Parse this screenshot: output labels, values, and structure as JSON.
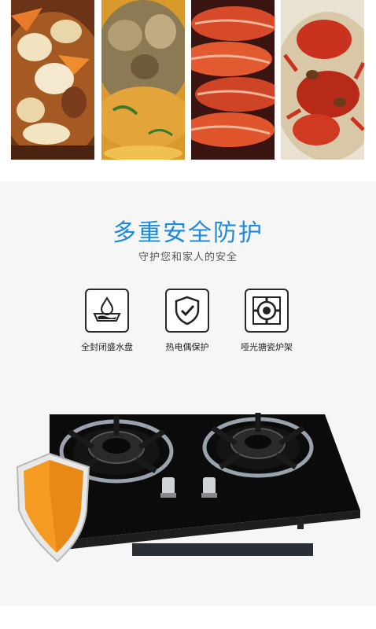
{
  "food_gallery": {
    "photos": [
      {
        "name": "stew-dish-photo"
      },
      {
        "name": "soup-pot-photo"
      },
      {
        "name": "prawns-photo"
      },
      {
        "name": "crabs-photo"
      }
    ]
  },
  "safety": {
    "title": "多重安全防护",
    "subtitle": "守护您和家人的安全",
    "features": [
      {
        "icon": "water-drop-pan-icon",
        "label": "全封闭盛水盘"
      },
      {
        "icon": "shield-check-icon",
        "label": "热电偶保护"
      },
      {
        "icon": "burner-grate-icon",
        "label": "哑光搪瓷炉架"
      }
    ]
  },
  "colors": {
    "accent": "#1e8bdc",
    "panel_bg": "#f6f6f6",
    "glass": "#0a0a0a",
    "shield_orange": "#f59a22"
  }
}
